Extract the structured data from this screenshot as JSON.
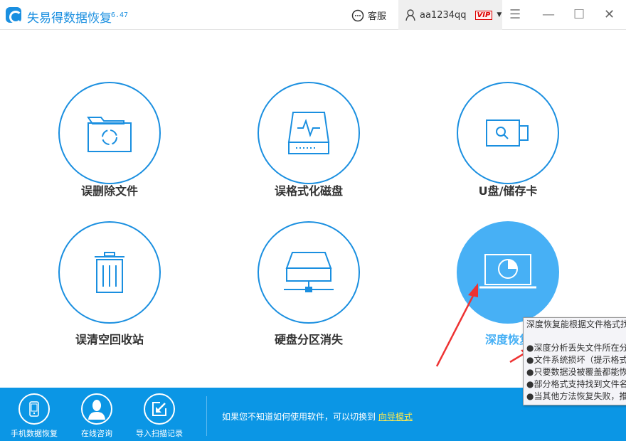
{
  "app": {
    "title": "失易得数据恢复",
    "version": "6.47"
  },
  "header": {
    "service_label": "客服",
    "username": "aa1234qq",
    "vip": "VIP"
  },
  "features": [
    {
      "label": "误删除文件",
      "icon": "folder-recycle-icon"
    },
    {
      "label": "误格式化磁盘",
      "icon": "disk-pulse-icon"
    },
    {
      "label": "U盘/储存卡",
      "icon": "usb-drive-icon"
    },
    {
      "label": "误清空回收站",
      "icon": "trash-icon"
    },
    {
      "label": "硬盘分区消失",
      "icon": "hard-drive-network-icon"
    },
    {
      "label": "深度恢复",
      "icon": "laptop-scan-icon"
    }
  ],
  "tooltip": {
    "title": "深度恢复能根据文件格式找",
    "items": [
      "●深度分析丢失文件所在分",
      "●文件系统损坏（提示格式",
      "●只要数据没被覆盖都能恢",
      "●部分格式支持找到文件名",
      "●当其他方法恢复失败，推"
    ]
  },
  "bottom": {
    "buttons": [
      "手机数据恢复",
      "在线咨询",
      "导入扫描记录"
    ],
    "hint": "如果您不知道如何使用软件，可以切换到",
    "link": "向导模式"
  },
  "colors": {
    "accent": "#1a8fe0",
    "bar": "#0b96e5",
    "active": "#47b0f5"
  }
}
